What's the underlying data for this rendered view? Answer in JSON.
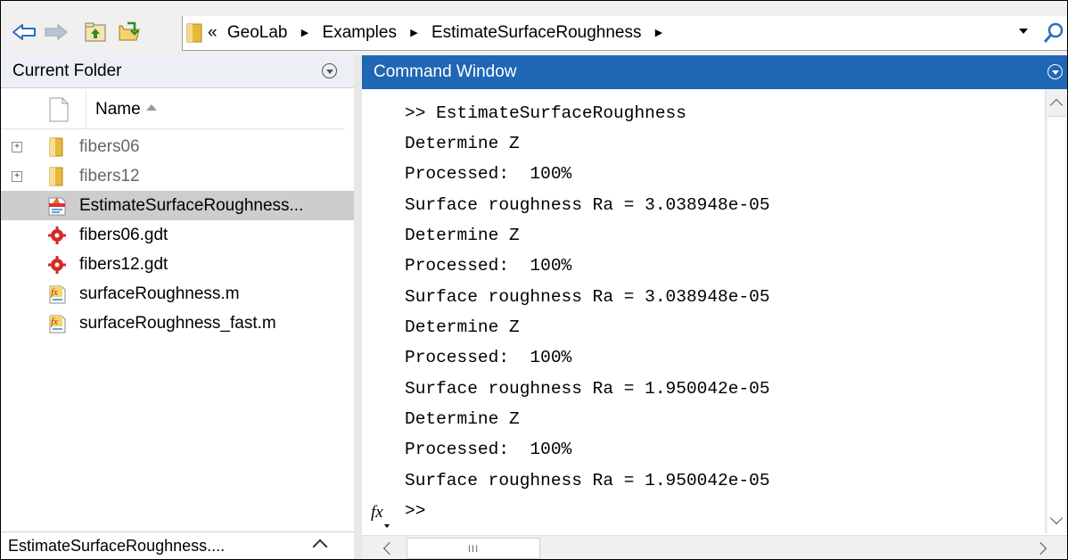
{
  "toolbar": {
    "back_icon": "back-arrow-icon",
    "forward_icon": "forward-arrow-icon",
    "up_folder_icon": "up-one-level-icon",
    "browse_icon": "browse-folder-icon",
    "breadcrumb_prefix": "«",
    "breadcrumbs": [
      "GeoLab",
      "Examples",
      "EstimateSurfaceRoughness"
    ]
  },
  "current_folder": {
    "title": "Current Folder",
    "column_header": "Name",
    "sort": "ascending",
    "items": [
      {
        "label": "fibers06",
        "type": "folder"
      },
      {
        "label": "fibers12",
        "type": "folder"
      },
      {
        "label": "EstimateSurfaceRoughness...",
        "type": "live-script",
        "selected": true
      },
      {
        "label": "fibers06.gdt",
        "type": "gdt-file"
      },
      {
        "label": "fibers12.gdt",
        "type": "gdt-file"
      },
      {
        "label": "surfaceRoughness.m",
        "type": "function-file"
      },
      {
        "label": "surfaceRoughness_fast.m",
        "type": "function-file"
      }
    ],
    "footer_label": "EstimateSurfaceRoughness...."
  },
  "command_window": {
    "title": "Command Window",
    "lines": [
      ">> EstimateSurfaceRoughness",
      "Determine Z",
      "Processed:  100%",
      "Surface roughness Ra = 3.038948e-05",
      "Determine Z",
      "Processed:  100%",
      "Surface roughness Ra = 3.038948e-05",
      "Determine Z",
      "Processed:  100%",
      "Surface roughness Ra = 1.950042e-05",
      "Determine Z",
      "Processed:  100%",
      "Surface roughness Ra = 1.950042e-05"
    ],
    "prompt": ">>",
    "fx_label": "fx",
    "scroll_grip": "III"
  },
  "colors": {
    "accent": "#1f66b5",
    "selection": "#cdcdcd",
    "folder": "#e8b83a"
  }
}
